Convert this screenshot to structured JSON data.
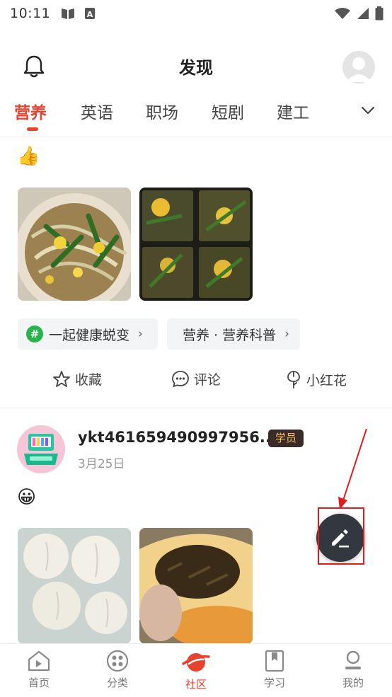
{
  "status_bar": {
    "time": "10:11"
  },
  "header": {
    "title": "发现"
  },
  "tabs": [
    {
      "label": "营养",
      "active": true
    },
    {
      "label": "英语",
      "active": false
    },
    {
      "label": "职场",
      "active": false
    },
    {
      "label": "短剧",
      "active": false
    },
    {
      "label": "建工",
      "active": false
    }
  ],
  "post1": {
    "emoji": "👍",
    "topics": [
      {
        "label": "一起健康蜕变",
        "icon": "#"
      },
      {
        "label": "营养 · 营养科普"
      }
    ],
    "actions": {
      "favorite": "收藏",
      "comment": "评论",
      "flower": "小红花"
    }
  },
  "post2": {
    "username": "ykt461659490997956...",
    "badge": "学员",
    "date": "3月25日",
    "emoji": "😀"
  },
  "bottom_nav": [
    {
      "label": "首页",
      "icon": "home-play-icon"
    },
    {
      "label": "分类",
      "icon": "category-icon"
    },
    {
      "label": "社区",
      "icon": "community-icon",
      "active": true
    },
    {
      "label": "学习",
      "icon": "bookmark-icon"
    },
    {
      "label": "我的",
      "icon": "profile-icon"
    }
  ],
  "colors": {
    "accent": "#e8432f",
    "fab": "#333840",
    "annotation": "#e21c1c",
    "topic_green": "#29b34d"
  }
}
